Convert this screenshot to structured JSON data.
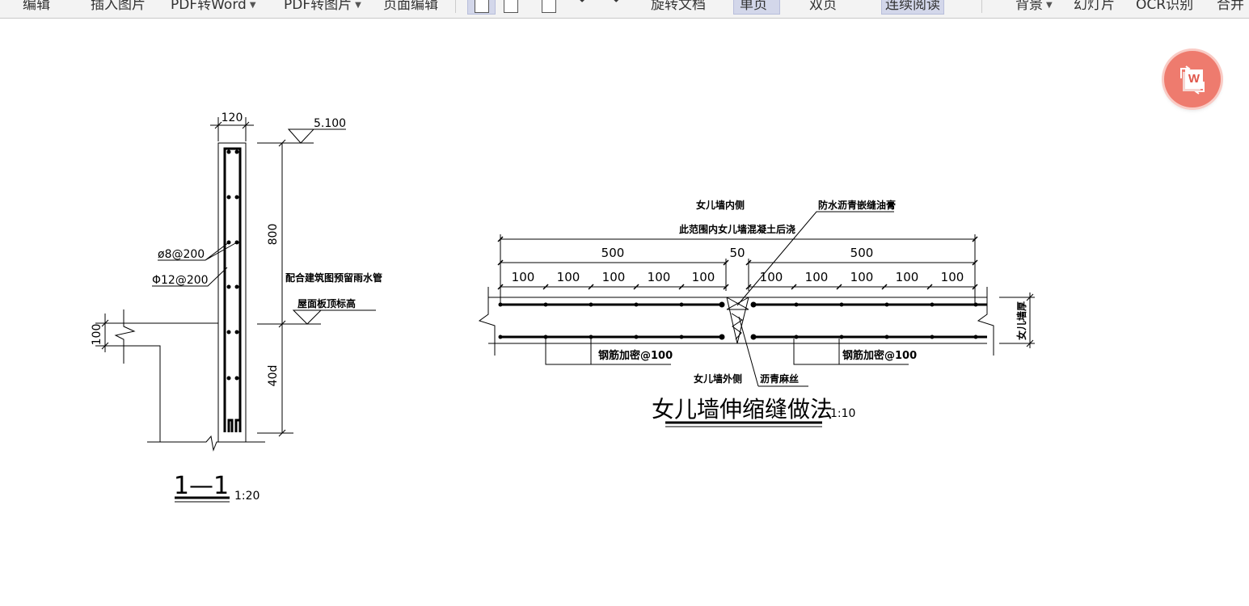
{
  "toolbar": {
    "items": [
      "编辑",
      "插入图片",
      "PDF转Word",
      "PDF转图片",
      "页面编辑",
      "旋转文档",
      "单页",
      "双页",
      "连续阅读",
      "背景",
      "幻灯片",
      "OCR识别",
      "合并"
    ],
    "active_items": [
      "单页",
      "连续阅读"
    ]
  },
  "fab": {
    "icon": "convert-to-word-icon",
    "label": "W",
    "color": "#ee7b6e"
  },
  "section_1_1": {
    "dim_width": "120",
    "elevation": "5.100",
    "dim_height": "800",
    "note_pipe": "配合建筑图预留雨水管",
    "roof_level": "屋面板顶标高",
    "rebar_1": "ø8@200",
    "rebar_2": "Φ12@200",
    "dim_slab": "100",
    "dim_anchor": "40d",
    "title": "1—1",
    "scale": "1:20"
  },
  "joint_detail": {
    "inner_side": "女儿墙内侧",
    "range_note": "此范围内女儿墙混凝土后浇",
    "sealant": "防水沥青嵌缝油膏",
    "dim_total_left": "500",
    "dim_gap": "50",
    "dim_total_right": "500",
    "dim_spacing": "100",
    "dense_rebar_left": "钢筋加密@100",
    "dense_rebar_right": "钢筋加密@100",
    "outer_side": "女儿墙外侧",
    "hemp": "沥青麻丝",
    "wall_thickness": "女儿墙厚",
    "title": "女儿墙伸缩缝做法",
    "scale": "1:10"
  }
}
